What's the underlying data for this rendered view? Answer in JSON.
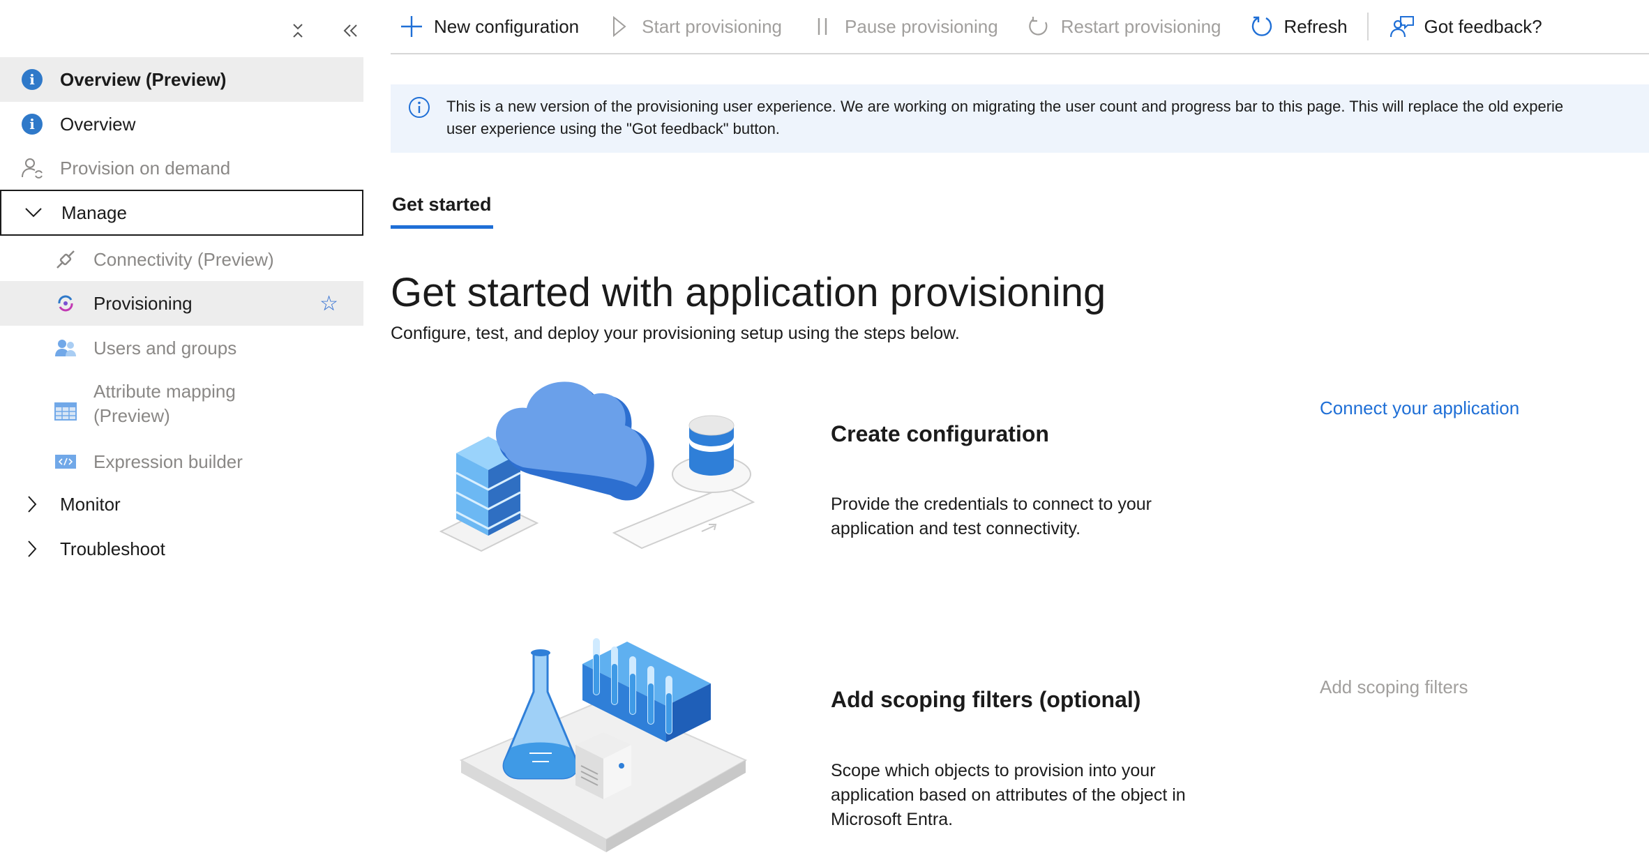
{
  "sidebar": {
    "top_icons": [
      "collapse-vertical-icon",
      "double-chevron-left-icon"
    ],
    "items": [
      {
        "label": "Overview (Preview)"
      },
      {
        "label": "Overview"
      },
      {
        "label": "Provision on demand"
      },
      {
        "label": "Manage"
      },
      {
        "label": "Connectivity (Preview)"
      },
      {
        "label": "Provisioning"
      },
      {
        "label": "Users and groups"
      },
      {
        "label": "Attribute mapping",
        "label2": "(Preview)"
      },
      {
        "label": "Expression builder"
      },
      {
        "label": "Monitor"
      },
      {
        "label": "Troubleshoot"
      }
    ]
  },
  "toolbar": {
    "new_config": "New configuration",
    "start": "Start provisioning",
    "pause": "Pause provisioning",
    "restart": "Restart provisioning",
    "refresh": "Refresh",
    "feedback": "Got feedback?"
  },
  "banner": {
    "line1": "This is a new version of the provisioning user experience. We are working on migrating the user count and progress bar to this page. This will replace the old experie",
    "line2": "user experience using the \"Got feedback\" button."
  },
  "tabs": [
    {
      "label": "Get started"
    }
  ],
  "main": {
    "title": "Get started with application provisioning",
    "subtitle": "Configure, test, and deploy your provisioning setup using the steps below."
  },
  "steps": [
    {
      "title": "Create configuration",
      "desc_line1": "Provide the credentials to connect to your",
      "desc_line2": "application and test connectivity.",
      "action": "Connect your application"
    },
    {
      "title": "Add scoping filters (optional)",
      "desc_line1": "Scope which objects to provision into your",
      "desc_line2": "application based on attributes of the object in",
      "desc_line3": "Microsoft Entra.",
      "action": "Add scoping filters"
    }
  ],
  "colors": {
    "accent": "#1f6fd6",
    "info": "#2f79c9",
    "selected_bg": "#ededed",
    "banner_bg": "#eef4fc",
    "disabled": "#a19f9d"
  }
}
